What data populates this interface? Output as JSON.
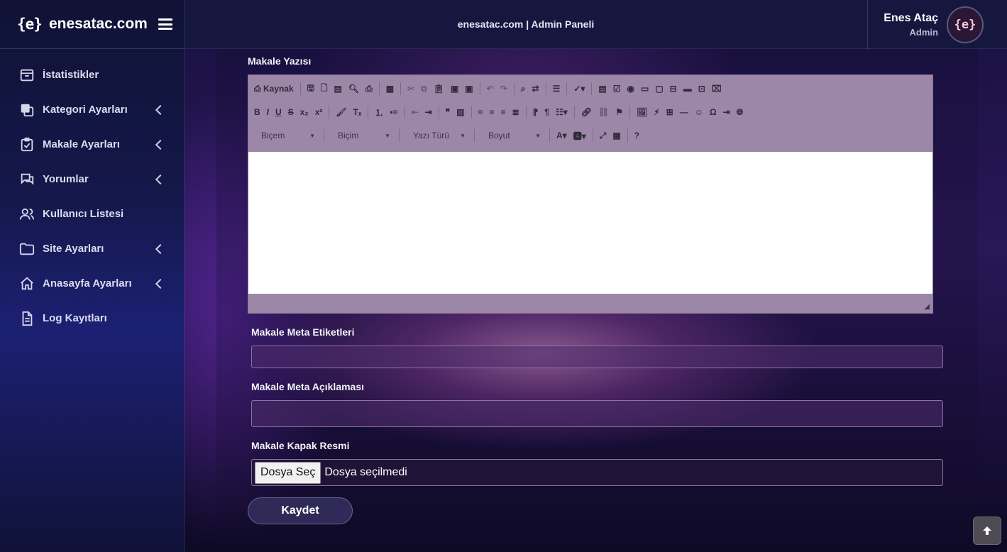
{
  "brand": {
    "logo": "{e}",
    "name": "enesatac.com"
  },
  "header": {
    "title": "enesatac.com | Admin Paneli"
  },
  "user": {
    "name": "Enes Ataç",
    "role": "Admin",
    "avatar_text": "{e}"
  },
  "sidebar": {
    "items": [
      {
        "label": "İstatistikler",
        "icon": "inbox-icon",
        "has_submenu": false
      },
      {
        "label": "Kategori Ayarları",
        "icon": "copy-icon",
        "has_submenu": true
      },
      {
        "label": "Makale Ayarları",
        "icon": "clipboard-check-icon",
        "has_submenu": true
      },
      {
        "label": "Yorumlar",
        "icon": "comments-icon",
        "has_submenu": true
      },
      {
        "label": "Kullanıcı Listesi",
        "icon": "users-icon",
        "has_submenu": false
      },
      {
        "label": "Site Ayarları",
        "icon": "folder-icon",
        "has_submenu": true
      },
      {
        "label": "Anasayfa Ayarları",
        "icon": "home-icon",
        "has_submenu": true
      },
      {
        "label": "Log Kayıtları",
        "icon": "file-text-icon",
        "has_submenu": false
      }
    ]
  },
  "form": {
    "article_text_label": "Makale Yazısı",
    "editor": {
      "source_label": "Kaynak",
      "style_combo": "Biçem",
      "format_combo": "Biçim",
      "font_combo": "Yazı Türü",
      "size_combo": "Boyut"
    },
    "meta_tags_label": "Makale Meta Etiketleri",
    "meta_tags_value": "",
    "meta_description_label": "Makale Meta Açıklaması",
    "meta_description_value": "",
    "cover_image_label": "Makale Kapak Resmi",
    "file_button_label": "Dosya Seç",
    "file_status": "Dosya seçilmedi",
    "save_label": "Kaydet"
  }
}
